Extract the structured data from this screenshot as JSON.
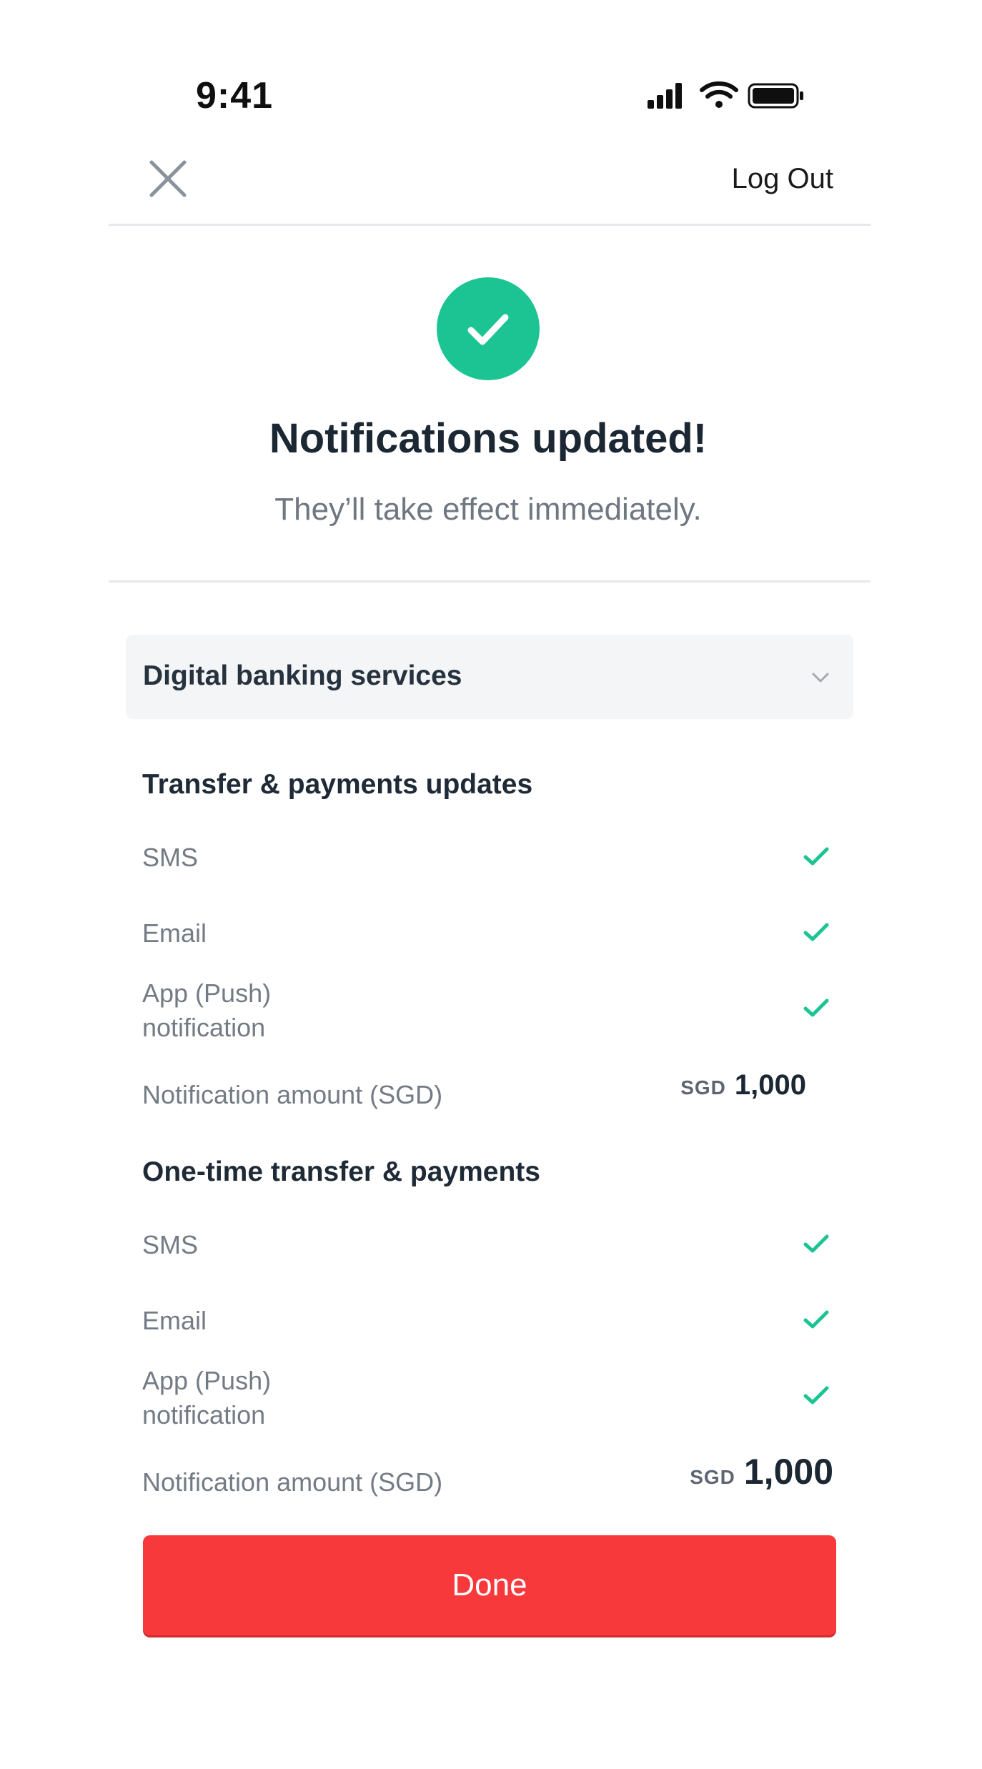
{
  "status_bar": {
    "time": "9:41"
  },
  "nav": {
    "logout_label": "Log Out"
  },
  "success": {
    "title": "Notifications updated!",
    "subtitle": "They’ll take effect immediately."
  },
  "accordion": {
    "label": "Digital banking services"
  },
  "sections": [
    {
      "title": "Transfer & payments updates",
      "rows": [
        {
          "label": "SMS",
          "checked": true
        },
        {
          "label": "Email",
          "checked": true
        },
        {
          "label_line1": "App (Push)",
          "label_line2": "notification",
          "checked": true
        }
      ],
      "amount": {
        "label": "Notification amount (SGD)",
        "currency": "SGD",
        "value": "1,000"
      }
    },
    {
      "title": "One-time transfer & payments",
      "rows": [
        {
          "label": "SMS",
          "checked": true
        },
        {
          "label": "Email",
          "checked": true
        },
        {
          "label_line1": "App (Push)",
          "label_line2": "notification",
          "checked": true
        }
      ],
      "amount": {
        "label": "Notification amount (SGD)",
        "currency": "SGD",
        "value": "1,000"
      }
    }
  ],
  "done_button": {
    "label": "Done"
  },
  "colors": {
    "accent_green": "#1dc493",
    "primary_red": "#f8393c"
  }
}
